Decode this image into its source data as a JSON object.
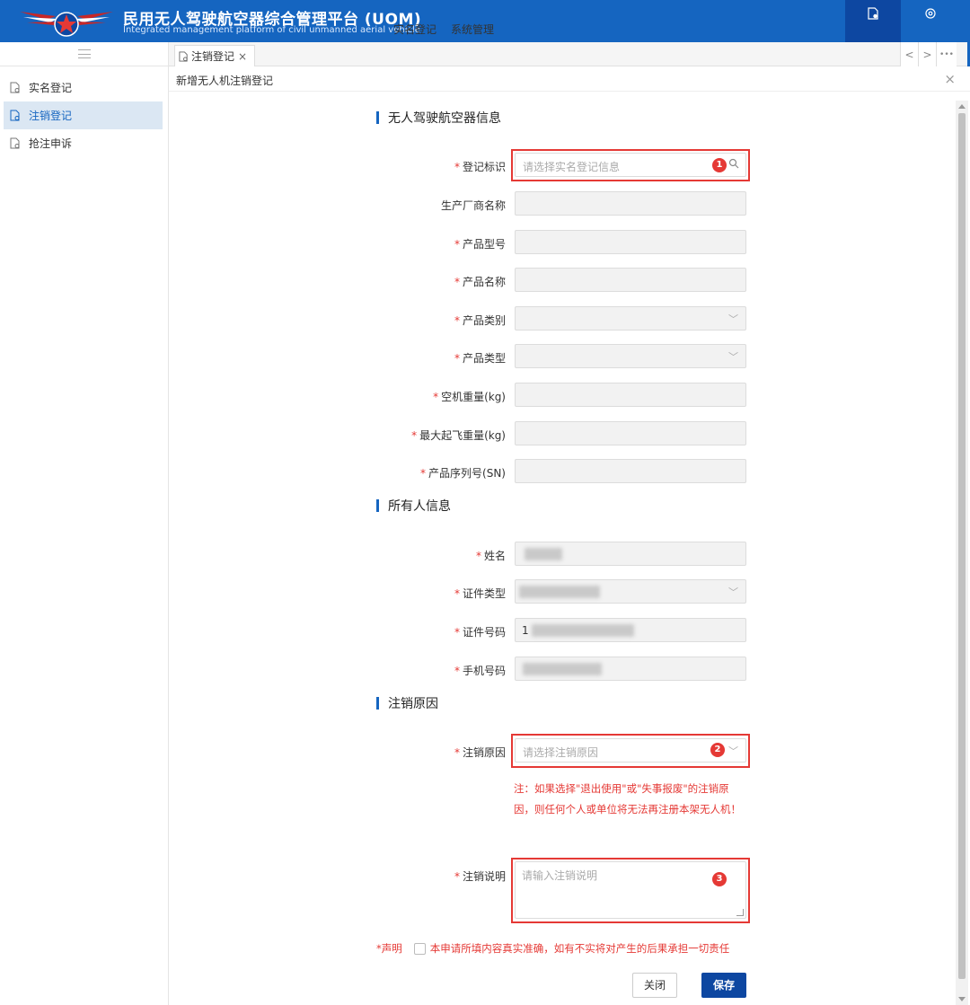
{
  "header": {
    "title_cn": "民用无人驾驶航空器综合管理平台 (UOM)",
    "title_en": "Integrated management platform of civil unmanned aerial vehicle",
    "nav": [
      {
        "label": "实名登记",
        "icon": "document-icon",
        "active": true
      },
      {
        "label": "系统管理",
        "icon": "settings-icon",
        "active": false
      }
    ]
  },
  "sidebar": {
    "items": [
      {
        "label": "实名登记",
        "active": false
      },
      {
        "label": "注销登记",
        "active": true
      },
      {
        "label": "抢注申诉",
        "active": false
      }
    ]
  },
  "tabs": [
    {
      "label": "注销登记",
      "close": "×"
    }
  ],
  "tab_nav": {
    "prev": "<",
    "next": ">",
    "more": "•••"
  },
  "page": {
    "title": "新增无人机注销登记",
    "close": "×"
  },
  "sections": {
    "uav": "无人驾驶航空器信息",
    "owner": "所有人信息",
    "cancel": "注销原因"
  },
  "uav_fields": {
    "reg_id": {
      "label": "登记标识",
      "required": true,
      "placeholder": "请选择实名登记信息"
    },
    "manufacturer": {
      "label": "生产厂商名称",
      "required": false
    },
    "model": {
      "label": "产品型号",
      "required": true
    },
    "product_name": {
      "label": "产品名称",
      "required": true
    },
    "category": {
      "label": "产品类别",
      "required": true
    },
    "type": {
      "label": "产品类型",
      "required": true
    },
    "empty_weight": {
      "label": "空机重量(kg)",
      "required": true
    },
    "max_takeoff": {
      "label": "最大起飞重量(kg)",
      "required": true
    },
    "serial": {
      "label": "产品序列号(SN)",
      "required": true
    }
  },
  "owner_fields": {
    "name": {
      "label": "姓名",
      "required": true
    },
    "id_type": {
      "label": "证件类型",
      "required": true
    },
    "id_number": {
      "label": "证件号码",
      "required": true,
      "value_prefix": "1"
    },
    "phone": {
      "label": "手机号码",
      "required": true
    }
  },
  "cancel_fields": {
    "reason": {
      "label": "注销原因",
      "required": true,
      "placeholder": "请选择注销原因"
    },
    "note": "注：如果选择\"退出使用\"或\"失事报废\"的注销原因，则任何个人或单位将无法再注册本架无人机！",
    "description": {
      "label": "注销说明",
      "required": true,
      "placeholder": "请输入注销说明"
    }
  },
  "declaration": {
    "key": "*声明",
    "text": "本申请所填内容真实准确，如有不实将对产生的后果承担一切责任"
  },
  "buttons": {
    "close": "关闭",
    "save": "保存"
  },
  "callouts": [
    "1",
    "2",
    "3"
  ],
  "colors": {
    "brand": "#1565c0",
    "highlight": "#e53935"
  }
}
